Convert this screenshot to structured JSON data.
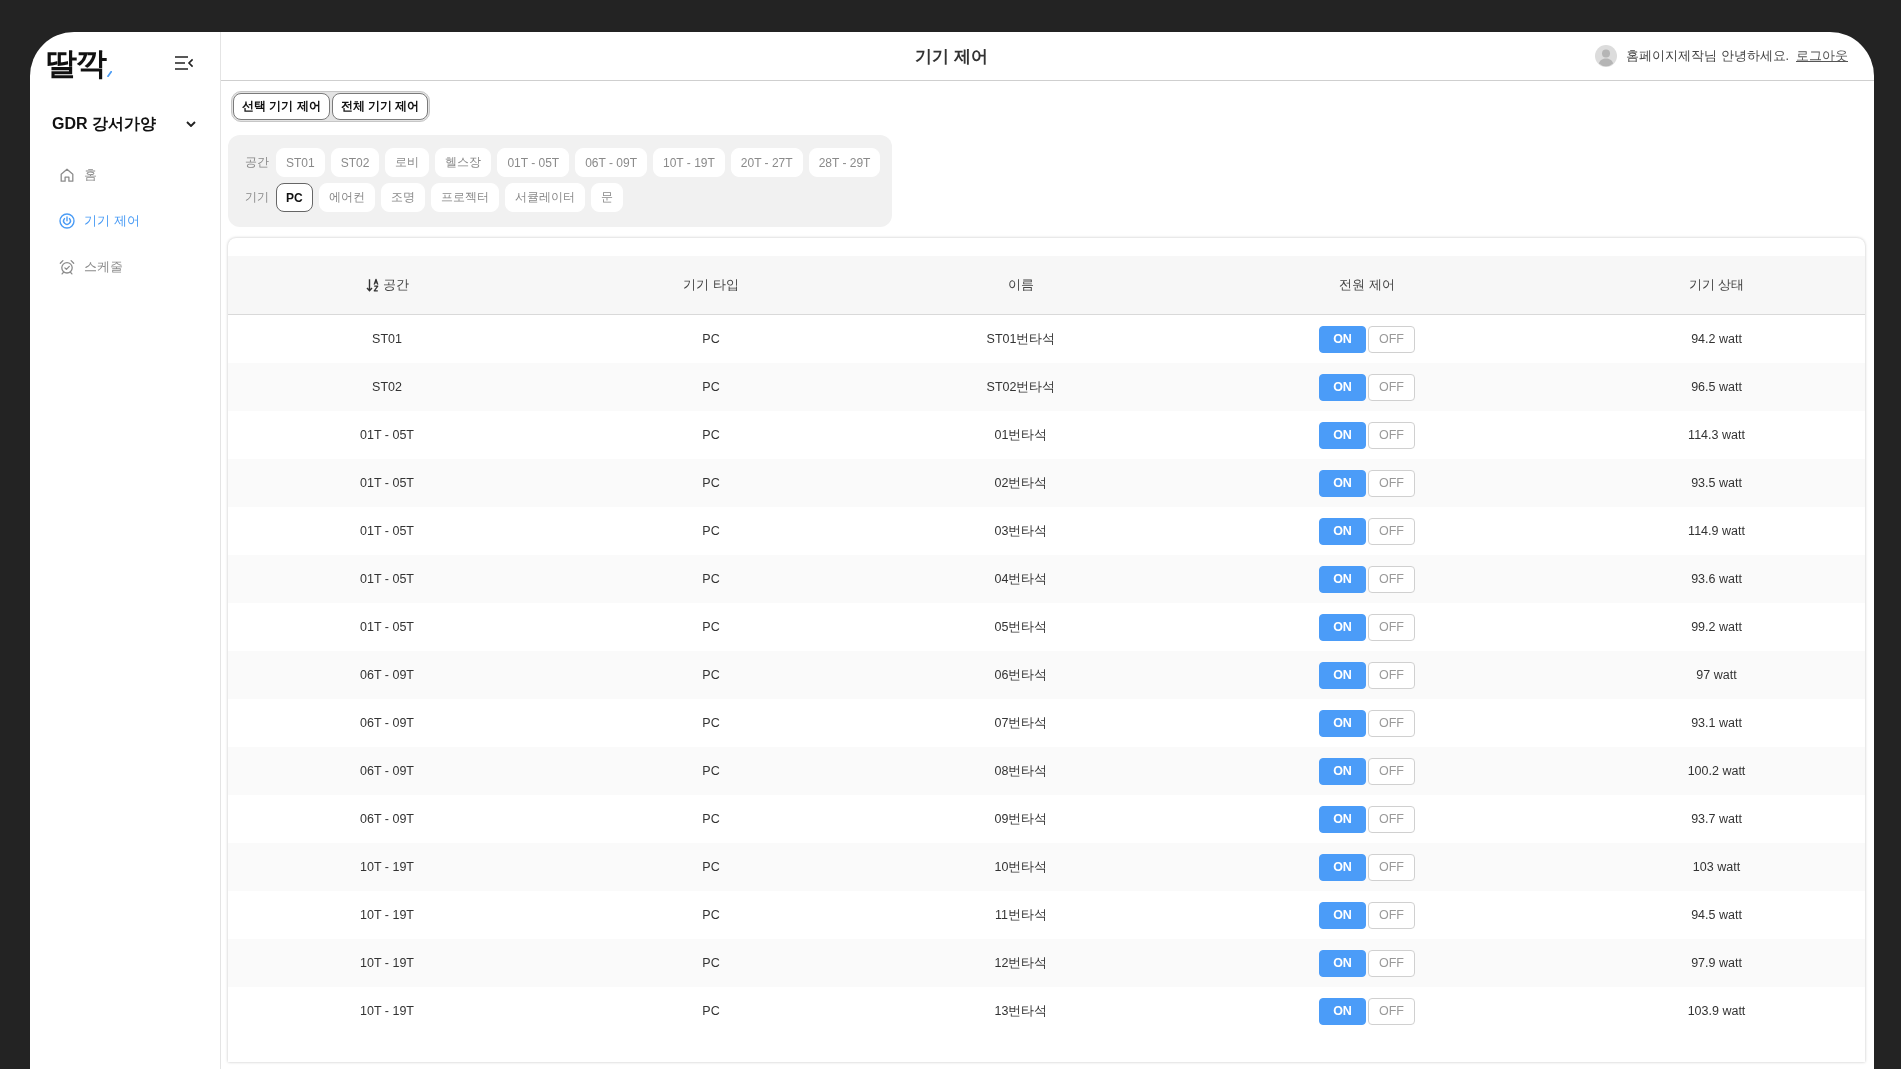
{
  "sidebar": {
    "logo": "딸깍",
    "workspace": "GDR 강서가양",
    "nav": [
      {
        "label": "홈",
        "selected": false
      },
      {
        "label": "기기 제어",
        "selected": true
      },
      {
        "label": "스케줄",
        "selected": false
      }
    ]
  },
  "header": {
    "title": "기기 제어",
    "greeting": "홈페이지제작님 안녕하세요.",
    "logout": "로그아웃"
  },
  "mode_buttons": [
    {
      "label": "선택 기기 제어"
    },
    {
      "label": "전체 기기 제어"
    }
  ],
  "filters": [
    {
      "label": "공간",
      "options": [
        {
          "label": "ST01",
          "selected": false
        },
        {
          "label": "ST02",
          "selected": false
        },
        {
          "label": "로비",
          "selected": false
        },
        {
          "label": "헬스장",
          "selected": false
        },
        {
          "label": "01T - 05T",
          "selected": false
        },
        {
          "label": "06T - 09T",
          "selected": false
        },
        {
          "label": "10T - 19T",
          "selected": false
        },
        {
          "label": "20T - 27T",
          "selected": false
        },
        {
          "label": "28T - 29T",
          "selected": false
        }
      ]
    },
    {
      "label": "기기",
      "options": [
        {
          "label": "PC",
          "selected": true
        },
        {
          "label": "에어컨",
          "selected": false
        },
        {
          "label": "조명",
          "selected": false
        },
        {
          "label": "프로젝터",
          "selected": false
        },
        {
          "label": "서큘레이터",
          "selected": false
        },
        {
          "label": "문",
          "selected": false
        }
      ]
    }
  ],
  "table": {
    "columns": [
      {
        "label": "공간",
        "sorted": true
      },
      {
        "label": "기기 타입",
        "sorted": false
      },
      {
        "label": "이름",
        "sorted": false
      },
      {
        "label": "전원 제어",
        "sorted": false
      },
      {
        "label": "기기 상태",
        "sorted": false
      }
    ],
    "rows": [
      {
        "zone": "ST01",
        "type": "PC",
        "name": "ST01번타석",
        "power": [
          {
            "label": "ON",
            "selected": true
          },
          {
            "label": "OFF",
            "selected": false
          }
        ],
        "reading": "94.2 watt"
      },
      {
        "zone": "ST02",
        "type": "PC",
        "name": "ST02번타석",
        "power": [
          {
            "label": "ON",
            "selected": true
          },
          {
            "label": "OFF",
            "selected": false
          }
        ],
        "reading": "96.5 watt"
      },
      {
        "zone": "01T - 05T",
        "type": "PC",
        "name": "01번타석",
        "power": [
          {
            "label": "ON",
            "selected": true
          },
          {
            "label": "OFF",
            "selected": false
          }
        ],
        "reading": "114.3 watt"
      },
      {
        "zone": "01T - 05T",
        "type": "PC",
        "name": "02번타석",
        "power": [
          {
            "label": "ON",
            "selected": true
          },
          {
            "label": "OFF",
            "selected": false
          }
        ],
        "reading": "93.5 watt"
      },
      {
        "zone": "01T - 05T",
        "type": "PC",
        "name": "03번타석",
        "power": [
          {
            "label": "ON",
            "selected": true
          },
          {
            "label": "OFF",
            "selected": false
          }
        ],
        "reading": "114.9 watt"
      },
      {
        "zone": "01T - 05T",
        "type": "PC",
        "name": "04번타석",
        "power": [
          {
            "label": "ON",
            "selected": true
          },
          {
            "label": "OFF",
            "selected": false
          }
        ],
        "reading": "93.6 watt"
      },
      {
        "zone": "01T - 05T",
        "type": "PC",
        "name": "05번타석",
        "power": [
          {
            "label": "ON",
            "selected": true
          },
          {
            "label": "OFF",
            "selected": false
          }
        ],
        "reading": "99.2 watt"
      },
      {
        "zone": "06T - 09T",
        "type": "PC",
        "name": "06번타석",
        "power": [
          {
            "label": "ON",
            "selected": true
          },
          {
            "label": "OFF",
            "selected": false
          }
        ],
        "reading": "97 watt"
      },
      {
        "zone": "06T - 09T",
        "type": "PC",
        "name": "07번타석",
        "power": [
          {
            "label": "ON",
            "selected": true
          },
          {
            "label": "OFF",
            "selected": false
          }
        ],
        "reading": "93.1 watt"
      },
      {
        "zone": "06T - 09T",
        "type": "PC",
        "name": "08번타석",
        "power": [
          {
            "label": "ON",
            "selected": true
          },
          {
            "label": "OFF",
            "selected": false
          }
        ],
        "reading": "100.2 watt"
      },
      {
        "zone": "06T - 09T",
        "type": "PC",
        "name": "09번타석",
        "power": [
          {
            "label": "ON",
            "selected": true
          },
          {
            "label": "OFF",
            "selected": false
          }
        ],
        "reading": "93.7 watt"
      },
      {
        "zone": "10T - 19T",
        "type": "PC",
        "name": "10번타석",
        "power": [
          {
            "label": "ON",
            "selected": true
          },
          {
            "label": "OFF",
            "selected": false
          }
        ],
        "reading": "103 watt"
      },
      {
        "zone": "10T - 19T",
        "type": "PC",
        "name": "11번타석",
        "power": [
          {
            "label": "ON",
            "selected": true
          },
          {
            "label": "OFF",
            "selected": false
          }
        ],
        "reading": "94.5 watt"
      },
      {
        "zone": "10T - 19T",
        "type": "PC",
        "name": "12번타석",
        "power": [
          {
            "label": "ON",
            "selected": true
          },
          {
            "label": "OFF",
            "selected": false
          }
        ],
        "reading": "97.9 watt"
      },
      {
        "zone": "10T - 19T",
        "type": "PC",
        "name": "13번타석",
        "power": [
          {
            "label": "ON",
            "selected": true
          },
          {
            "label": "OFF",
            "selected": false
          }
        ],
        "reading": "103.9 watt"
      }
    ]
  }
}
